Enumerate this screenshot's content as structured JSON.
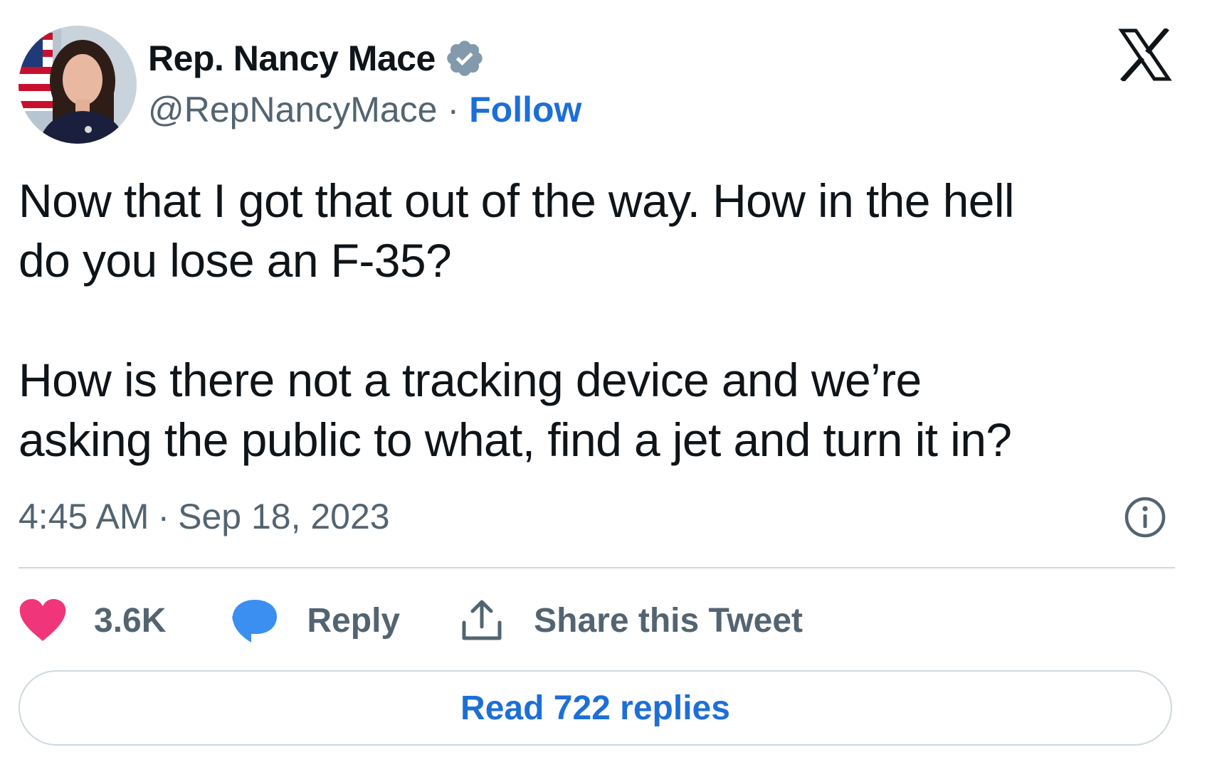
{
  "author": {
    "display_name": "Rep. Nancy Mace",
    "handle": "@RepNancyMace",
    "separator": "·",
    "follow_label": "Follow",
    "avatar_icon": "profile-photo",
    "verified_icon": "verified-badge-icon"
  },
  "platform": {
    "logo_icon": "x-logo-icon"
  },
  "tweet": {
    "paragraph_1_line_1": "Now that I got that out of the way. How in the hell",
    "paragraph_1_line_2": "do you lose an F-35?",
    "paragraph_2_line_1": "How is there not a tracking device and we’re",
    "paragraph_2_line_2": "asking the public to what, find a jet and turn it in?",
    "time": "4:45 AM",
    "separator": "·",
    "date": "Sep 18, 2023",
    "info_icon": "info-icon"
  },
  "actions": {
    "likes_count": "3.6K",
    "reply_label": "Reply",
    "share_label": "Share this Tweet"
  },
  "replies_button": {
    "label": "Read 722 replies"
  },
  "colors": {
    "text_primary": "#0f1419",
    "text_secondary": "#536471",
    "link_blue": "#1d6fd6",
    "heart_pink": "#f0357a",
    "reply_blue": "#3a8ff0",
    "verified_gray": "#829aab",
    "border": "#cfd9de"
  }
}
